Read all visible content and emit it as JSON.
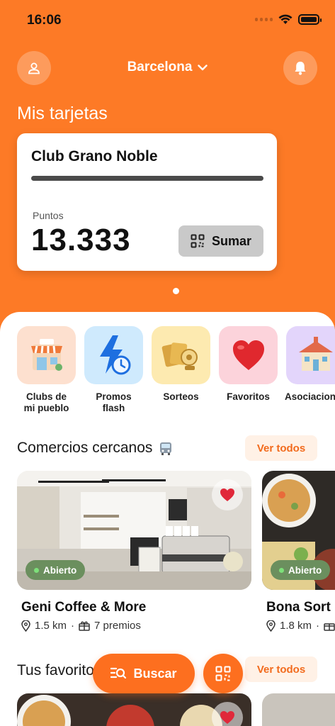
{
  "status_bar": {
    "time": "16:06"
  },
  "header": {
    "city": "Barcelona",
    "profile_icon": "user-icon",
    "notifications_icon": "bell-icon"
  },
  "cards_section": {
    "title": "Mis tarjetas",
    "card": {
      "name": "Club Grano Noble",
      "points_label": "Puntos",
      "points": "13.333",
      "add_button": "Sumar"
    }
  },
  "categories": [
    {
      "label": "Clubs de\nmi pueblo",
      "icon": "shop-icon",
      "bg": "#fde0cf"
    },
    {
      "label": "Promos\nflash",
      "icon": "lightning-clock-icon",
      "bg": "#cfeafd"
    },
    {
      "label": "Sorteos",
      "icon": "lottery-tickets-icon",
      "bg": "#fdeab0"
    },
    {
      "label": "Favoritos",
      "icon": "heart-icon",
      "bg": "#fcd3db"
    },
    {
      "label": "Asociaciones",
      "icon": "town-hall-icon",
      "bg": "#e3d5fb"
    }
  ],
  "nearby": {
    "title": "Comercios cercanos",
    "title_icon": "bus-stop-icon",
    "see_all": "Ver todos",
    "shops": [
      {
        "name": "Geni Coffee & More",
        "status": "Abierto",
        "distance": "1.5 km",
        "separator": "·",
        "rewards": "7 premios"
      },
      {
        "name": "Bona Sort",
        "status": "Abierto",
        "distance": "1.8 km",
        "separator": "·",
        "rewards": ""
      }
    ]
  },
  "favorites": {
    "title": "Tus favoritos",
    "see_all": "Ver todos"
  },
  "bottom_actions": {
    "search_label": "Buscar",
    "search_icon": "search-list-icon",
    "qr_icon": "qr-code-icon"
  },
  "colors": {
    "brand_orange": "#fd7a26",
    "open_green": "#6b8f5e",
    "see_all_bg": "#fff1e6"
  }
}
